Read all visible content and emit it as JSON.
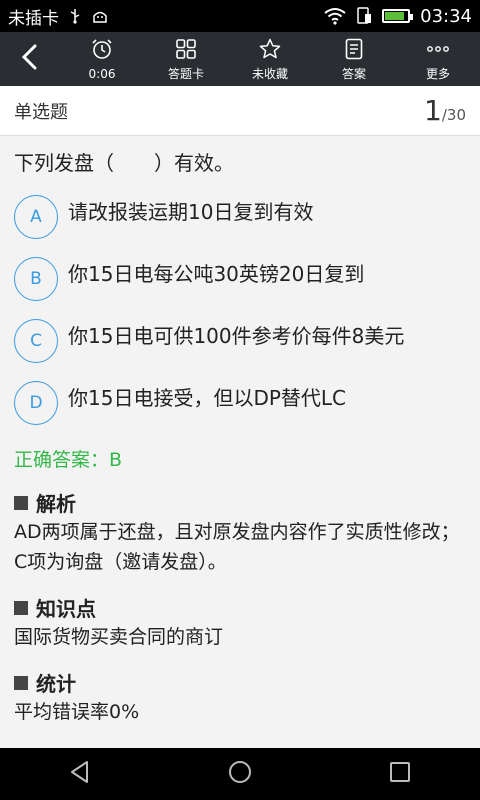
{
  "status": {
    "carrier": "未插卡",
    "time": "03:34"
  },
  "toolbar": {
    "items": [
      {
        "label": "0:06",
        "icon": "alarm-clock-icon"
      },
      {
        "label": "答题卡",
        "icon": "grid-icon"
      },
      {
        "label": "未收藏",
        "icon": "star-icon"
      },
      {
        "label": "答案",
        "icon": "document-icon"
      },
      {
        "label": "更多",
        "icon": "more-dots-icon"
      }
    ]
  },
  "header": {
    "type": "单选题",
    "current": "1",
    "total": "/30"
  },
  "question": {
    "text": "下列发盘（　　）有效。",
    "options": [
      {
        "letter": "A",
        "text": "请改报装运期10日复到有效"
      },
      {
        "letter": "B",
        "text": "你15日电每公吨30英镑20日复到"
      },
      {
        "letter": "C",
        "text": "你15日电可供100件参考价每件8美元"
      },
      {
        "letter": "D",
        "text": "你15日电接受，但以DP替代LC"
      }
    ]
  },
  "answer": "正确答案：B",
  "analysis": {
    "title": "解析",
    "body": "AD两项属于还盘，且对原发盘内容作了实质性修改；C项为询盘（邀请发盘）。"
  },
  "knowledge": {
    "title": "知识点",
    "body": "国际货物买卖合同的商订"
  },
  "stats": {
    "title": "统计",
    "body": "平均错误率0%"
  },
  "colors": {
    "accent": "#3a9be0",
    "correct": "#35b84a",
    "toolbar": "#2a2e33"
  }
}
